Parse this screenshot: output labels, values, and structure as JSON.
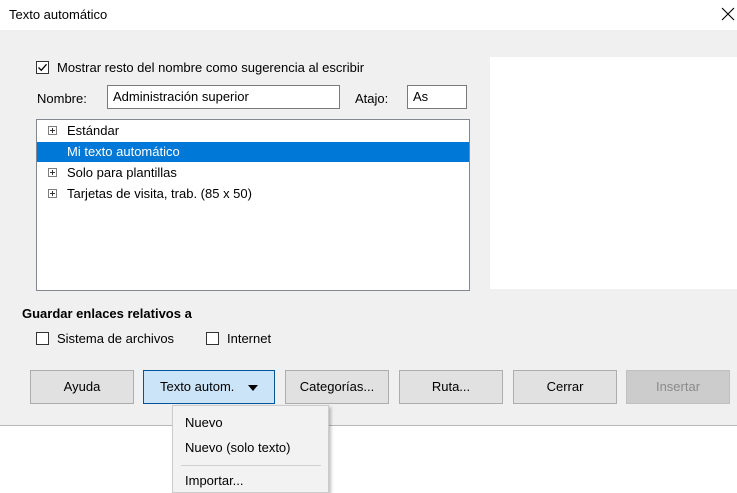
{
  "window": {
    "title": "Texto automático"
  },
  "options": {
    "show_remainder": {
      "label": "Mostrar resto del nombre como sugerencia al escribir",
      "checked": true
    }
  },
  "fields": {
    "name_label": "Nombre:",
    "name_value": "Administración superior",
    "shortcut_label": "Atajo:",
    "shortcut_value": "As"
  },
  "tree": {
    "items": [
      {
        "label": "Estándar",
        "expandable": true
      },
      {
        "label": "Mi texto automático",
        "expandable": false,
        "selected": true
      },
      {
        "label": "Solo para plantillas",
        "expandable": true
      },
      {
        "label": "Tarjetas de visita, trab. (85 x 50)",
        "expandable": true
      }
    ]
  },
  "links": {
    "heading": "Guardar enlaces relativos a",
    "filesystem": {
      "label": "Sistema de archivos",
      "checked": false
    },
    "internet": {
      "label": "Internet",
      "checked": false
    }
  },
  "buttons": {
    "help": "Ayuda",
    "autotext": "Texto autom.",
    "categories": "Categorías...",
    "path": "Ruta...",
    "close": "Cerrar",
    "insert": "Insertar"
  },
  "menu": {
    "items": [
      "Nuevo",
      "Nuevo (solo texto)",
      "Importar..."
    ]
  },
  "colors": {
    "selection": "#0078d7",
    "dialog_bg": "#f0f0f0",
    "pressed_button": "#cce4f7"
  }
}
